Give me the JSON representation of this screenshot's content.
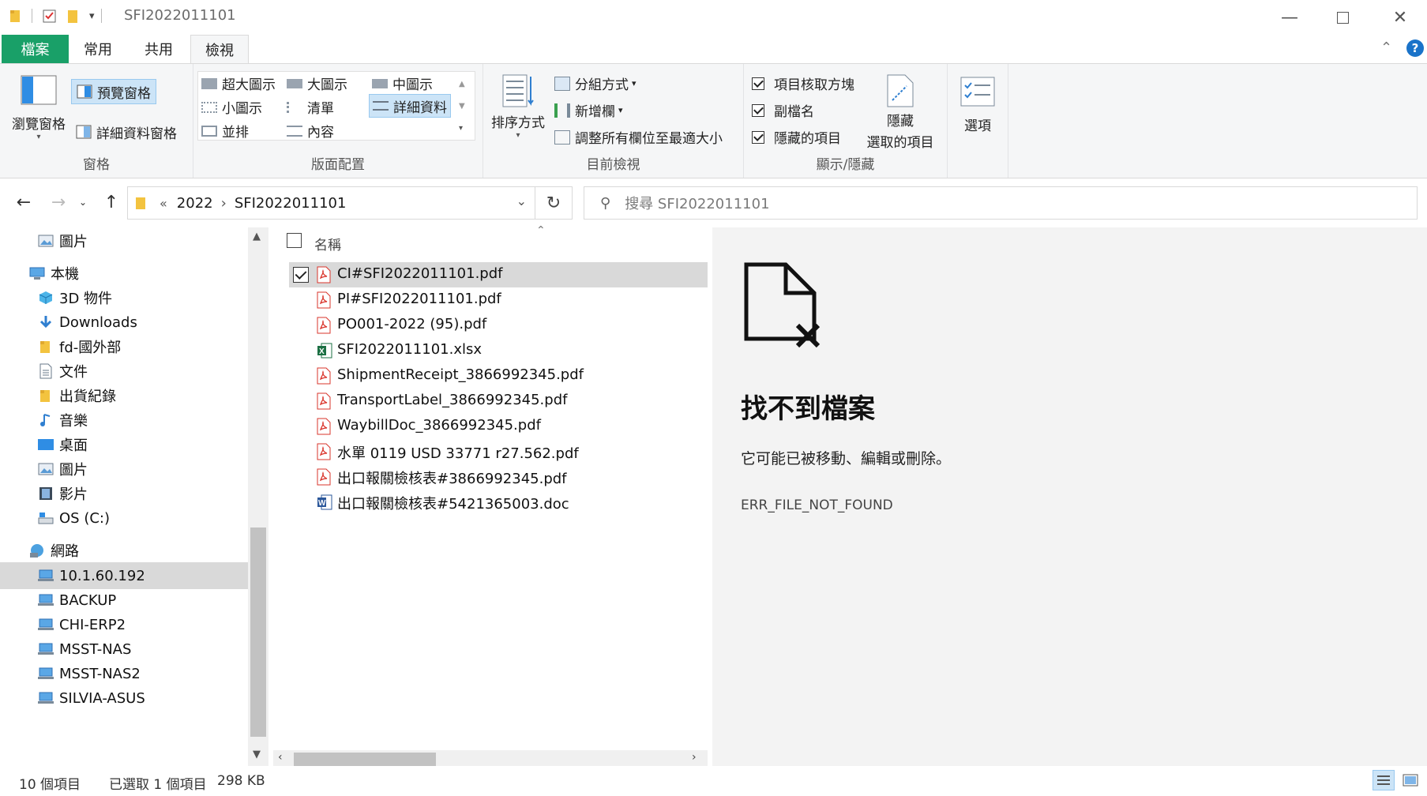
{
  "window": {
    "title": "SFI2022011101"
  },
  "ribbon_tabs": {
    "file": "檔案",
    "home": "常用",
    "share": "共用",
    "view": "檢視"
  },
  "ribbon": {
    "panes": {
      "navigation_pane": "瀏覽窗格",
      "preview_pane": "預覽窗格",
      "details_pane": "詳細資料窗格",
      "group_label": "窗格"
    },
    "layout": {
      "extra_large_icons": "超大圖示",
      "large_icons": "大圖示",
      "medium_icons": "中圖示",
      "small_icons": "小圖示",
      "list": "清單",
      "details": "詳細資料",
      "tiles": "並排",
      "content": "內容",
      "group_label": "版面配置"
    },
    "current_view": {
      "sort_by": "排序方式",
      "group_by": "分組方式",
      "add_columns": "新增欄",
      "size_columns": "調整所有欄位至最適大小",
      "group_label": "目前檢視"
    },
    "show_hide": {
      "item_checkboxes": "項目核取方塊",
      "file_extensions": "副檔名",
      "hidden_items": "隱藏的項目",
      "hide_selected_line1": "隱藏",
      "hide_selected_line2": "選取的項目",
      "group_label": "顯示/隱藏"
    },
    "options": "選項"
  },
  "address": {
    "overflow": "«",
    "crumbs": [
      "2022",
      "SFI2022011101"
    ],
    "search_placeholder": "搜尋 SFI2022011101"
  },
  "nav_tree": [
    {
      "label": "圖片",
      "icon": "pictures-icon",
      "indent": 2
    },
    {
      "label": "本機",
      "icon": "this-pc-icon",
      "indent": 1
    },
    {
      "label": "3D 物件",
      "icon": "3d-objects-icon",
      "indent": 2
    },
    {
      "label": "Downloads",
      "icon": "downloads-icon",
      "indent": 2
    },
    {
      "label": "fd-國外部",
      "icon": "folder-icon",
      "indent": 2
    },
    {
      "label": "文件",
      "icon": "documents-icon",
      "indent": 2
    },
    {
      "label": "出貨紀錄",
      "icon": "folder-icon",
      "indent": 2
    },
    {
      "label": "音樂",
      "icon": "music-icon",
      "indent": 2
    },
    {
      "label": "桌面",
      "icon": "desktop-icon",
      "indent": 2
    },
    {
      "label": "圖片",
      "icon": "pictures-icon",
      "indent": 2
    },
    {
      "label": "影片",
      "icon": "videos-icon",
      "indent": 2
    },
    {
      "label": "OS (C:)",
      "icon": "drive-icon",
      "indent": 2
    },
    {
      "label": "網路",
      "icon": "network-icon",
      "indent": 1
    },
    {
      "label": "10.1.60.192",
      "icon": "computer-icon",
      "indent": 2,
      "selected": true
    },
    {
      "label": "BACKUP",
      "icon": "computer-icon",
      "indent": 2
    },
    {
      "label": "CHI-ERP2",
      "icon": "computer-icon",
      "indent": 2
    },
    {
      "label": "MSST-NAS",
      "icon": "computer-icon",
      "indent": 2
    },
    {
      "label": "MSST-NAS2",
      "icon": "computer-icon",
      "indent": 2
    },
    {
      "label": "SILVIA-ASUS",
      "icon": "computer-icon",
      "indent": 2
    }
  ],
  "file_list": {
    "column_name": "名稱",
    "files": [
      {
        "name": "CI#SFI2022011101.pdf",
        "type": "pdf",
        "selected": true
      },
      {
        "name": "PI#SFI2022011101.pdf",
        "type": "pdf"
      },
      {
        "name": "PO001-2022 (95).pdf",
        "type": "pdf"
      },
      {
        "name": "SFI2022011101.xlsx",
        "type": "xlsx"
      },
      {
        "name": "ShipmentReceipt_3866992345.pdf",
        "type": "pdf"
      },
      {
        "name": "TransportLabel_3866992345.pdf",
        "type": "pdf"
      },
      {
        "name": "WaybillDoc_3866992345.pdf",
        "type": "pdf"
      },
      {
        "name": "水單 0119 USD 33771 r27.562.pdf",
        "type": "pdf"
      },
      {
        "name": "出口報關檢核表#3866992345.pdf",
        "type": "pdf"
      },
      {
        "name": "出口報關檢核表#5421365003.doc",
        "type": "doc"
      }
    ]
  },
  "preview": {
    "title": "找不到檔案",
    "message": "它可能已被移動、編輯或刪除。",
    "code": "ERR_FILE_NOT_FOUND"
  },
  "status": {
    "count": "10 個項目",
    "selection": "已選取 1 個項目",
    "size": "298 KB"
  },
  "colors": {
    "file_tab": "#19a068",
    "selection": "#d9d9d9",
    "ribbon_selected": "#cce4f7",
    "pdf": "#d9342b",
    "excel": "#1d7044",
    "word": "#2b579a"
  }
}
